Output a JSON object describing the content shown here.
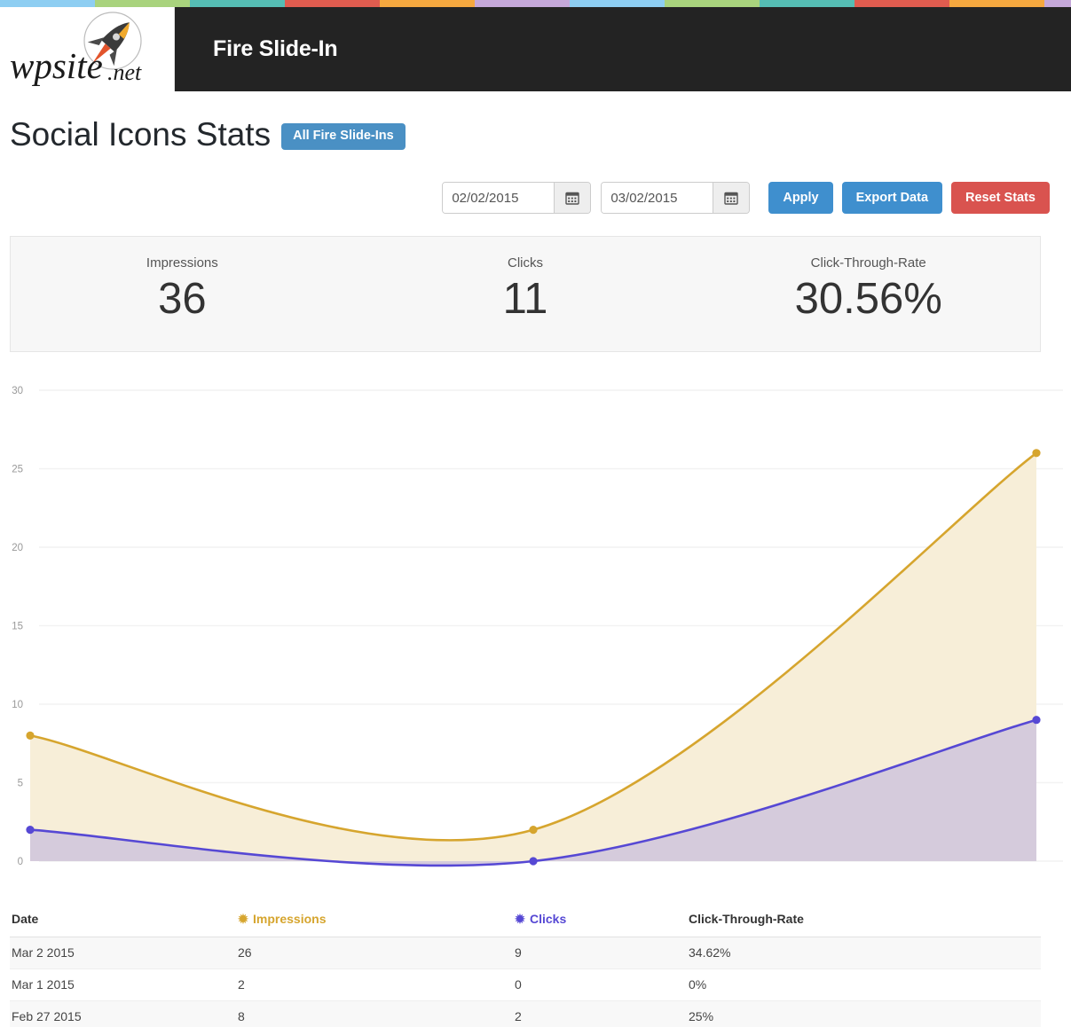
{
  "stripe": {
    "colors": [
      "#8ecef2",
      "#a9d37d",
      "#55bdb4",
      "#e05c4f",
      "#f5a83f",
      "#c5a8d9"
    ],
    "segment_count": 12
  },
  "header": {
    "logo_text": "wpsite",
    "logo_suffix": ".net",
    "logo_icon": "rocket-icon",
    "title": "Fire Slide-In",
    "background": "#232323"
  },
  "page": {
    "title": "Social Icons Stats",
    "all_button_label": "All Fire Slide-Ins",
    "accent_blue": "#3f8fce",
    "accent_red": "#d9534f"
  },
  "toolbar": {
    "start_date": "02/02/2015",
    "start_date_placeholder": "mm/dd/yyyy",
    "end_date": "03/02/2015",
    "end_date_placeholder": "mm/dd/yyyy",
    "calendar_icon": "calendar-icon",
    "apply_label": "Apply",
    "export_label": "Export Data",
    "reset_label": "Reset Stats"
  },
  "summary": {
    "cells": [
      {
        "label": "Impressions",
        "value": "36"
      },
      {
        "label": "Clicks",
        "value": "11"
      },
      {
        "label": "Click-Through-Rate",
        "value": "30.56%"
      }
    ]
  },
  "chart_data": {
    "type": "area",
    "title": "",
    "xlabel": "",
    "ylabel": "",
    "ylim": [
      0,
      30
    ],
    "yticks": [
      0,
      5,
      10,
      15,
      20,
      25,
      30
    ],
    "ytick_labels": [
      "0",
      "5",
      "10",
      "15",
      "20",
      "25",
      "30"
    ],
    "grid": true,
    "legend_position": "none",
    "x": [
      "Feb 27 2015",
      "Mar 1 2015",
      "Mar 2 2015"
    ],
    "xtick_labels": [
      "",
      "",
      ""
    ],
    "series": [
      {
        "name": "Impressions",
        "values": [
          8,
          2,
          26
        ],
        "line_color": "#d6a52e",
        "fill_color": "#f7eed8",
        "point_color": "#d6a52e"
      },
      {
        "name": "Clicks",
        "values": [
          2,
          0,
          9
        ],
        "line_color": "#5648d4",
        "fill_color": "#d5cbdc",
        "point_color": "#5648d4"
      }
    ]
  },
  "table": {
    "headers": {
      "date": "Date",
      "impressions": "Impressions",
      "clicks": "Clicks",
      "ctr": "Click-Through-Rate"
    },
    "header_markers": {
      "impressions": "✹",
      "clicks": "✹"
    },
    "rows": [
      {
        "date": "Mar 2 2015",
        "impressions": "26",
        "clicks": "9",
        "ctr": "34.62%"
      },
      {
        "date": "Mar 1 2015",
        "impressions": "2",
        "clicks": "0",
        "ctr": "0%"
      },
      {
        "date": "Feb 27 2015",
        "impressions": "8",
        "clicks": "2",
        "ctr": "25%"
      }
    ]
  }
}
